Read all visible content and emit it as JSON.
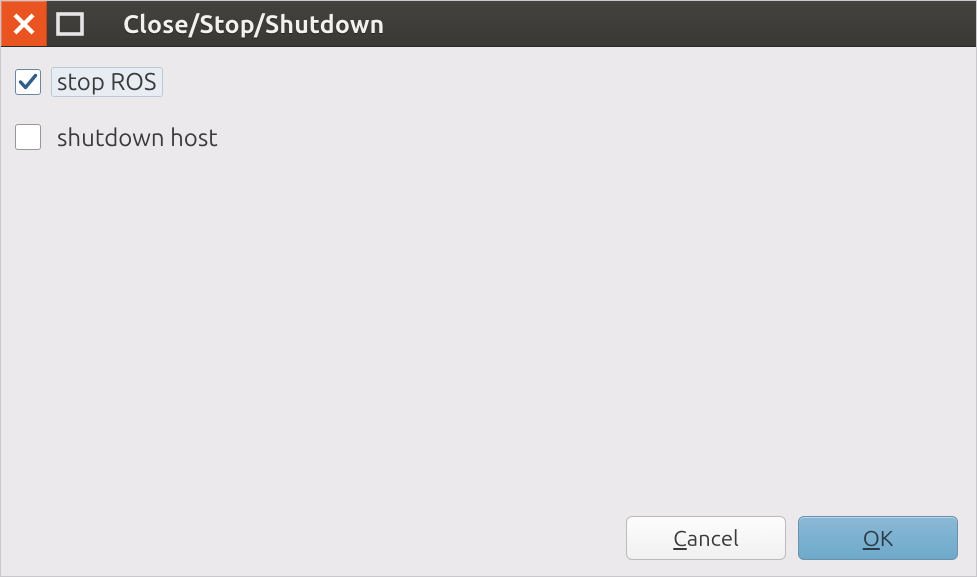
{
  "window": {
    "title": "Close/Stop/Shutdown"
  },
  "options": {
    "stop_ros": {
      "label": "stop ROS",
      "checked": true,
      "focused": true
    },
    "shutdown": {
      "label": "shutdown host",
      "checked": false,
      "focused": false
    }
  },
  "buttons": {
    "cancel": {
      "mnemonic": "C",
      "rest": "ancel"
    },
    "ok": {
      "mnemonic": "O",
      "rest": "K"
    }
  }
}
